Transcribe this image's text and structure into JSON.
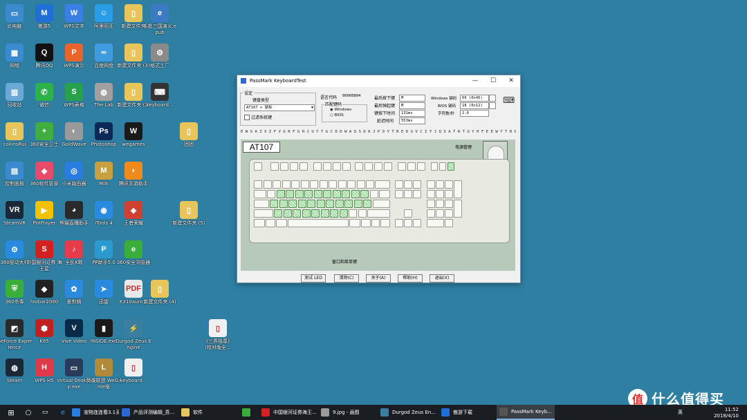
{
  "desktop": {
    "icons": [
      {
        "label": "此电脑",
        "color": "#3a8ad0",
        "glyph": "▭"
      },
      {
        "label": "傲游5",
        "color": "#1f6fd6",
        "glyph": "M"
      },
      {
        "label": "WPS文字",
        "color": "#3a7ee6",
        "glyph": "W"
      },
      {
        "label": "阿里旺旺",
        "color": "#2a9de8",
        "glyph": "☺"
      },
      {
        "label": "新建文件夹",
        "color": "#e8c55a",
        "glyph": "▯"
      },
      {
        "label": "毛批三国演义.epub",
        "color": "#3b7bc4",
        "glyph": "e"
      },
      {
        "label": "网络",
        "color": "#3a8ad0",
        "glyph": "▦"
      },
      {
        "label": "腾讯QQ",
        "color": "#111111",
        "glyph": "Q"
      },
      {
        "label": "WPS演示",
        "color": "#e8642a",
        "glyph": "P"
      },
      {
        "label": "百度网盘",
        "color": "#3f9be0",
        "glyph": "∞"
      },
      {
        "label": "新建文件夹 (3)",
        "color": "#e8c55a",
        "glyph": "▯"
      },
      {
        "label": "格式工厂",
        "color": "#8a8a8a",
        "glyph": "⚙"
      },
      {
        "label": "回收站",
        "color": "#6aa8d8",
        "glyph": "▥"
      },
      {
        "label": "微信",
        "color": "#2db14b",
        "glyph": "✆"
      },
      {
        "label": "WPS表格",
        "color": "#27a14b",
        "glyph": "S"
      },
      {
        "label": "The Lab",
        "color": "#a0a0a0",
        "glyph": "◍"
      },
      {
        "label": "新建文件夹 (2)",
        "color": "#e8c55a",
        "glyph": "▯"
      },
      {
        "label": "keyboard...",
        "color": "#333333",
        "glyph": "⌨"
      },
      {
        "label": "collinsRui",
        "color": "#e8c55a",
        "glyph": "▯"
      },
      {
        "label": "360安全卫士",
        "color": "#3fae3f",
        "glyph": "+"
      },
      {
        "label": "GoldWave",
        "color": "#9a9a9a",
        "glyph": "◐"
      },
      {
        "label": "Photoshop",
        "color": "#0b2a5a",
        "glyph": "Ps"
      },
      {
        "label": "wegames",
        "color": "#1a1a1a",
        "glyph": "W"
      },
      {
        "label": "团团",
        "color": "#e8c55a",
        "glyph": "▯"
      },
      {
        "label": "控制面板",
        "color": "#3a8ad0",
        "glyph": "▤"
      },
      {
        "label": "360软件管家",
        "color": "#e84a6a",
        "glyph": "◆"
      },
      {
        "label": "小米路由器",
        "color": "#2a7de0",
        "glyph": "◎"
      },
      {
        "label": "Milk",
        "color": "#c8a040",
        "glyph": "M"
      },
      {
        "label": "腾讯手游助手",
        "color": "#f08a1a",
        "glyph": "◗"
      },
      {
        "label": "SteamVR",
        "color": "#1b2838",
        "glyph": "VR"
      },
      {
        "label": "PotPlayer",
        "color": "#f2c200",
        "glyph": "▶"
      },
      {
        "label": "熊猫直播助手",
        "color": "#2a2a2a",
        "glyph": "◕"
      },
      {
        "label": "iTools 4",
        "color": "#2a8ae0",
        "glyph": "◉"
      },
      {
        "label": "王者荣耀",
        "color": "#d04030",
        "glyph": "◈"
      },
      {
        "label": "新建文件夹 (5)",
        "color": "#e8c55a",
        "glyph": "▯"
      },
      {
        "label": "360驱动大师",
        "color": "#2a8ae0",
        "glyph": "⚙"
      },
      {
        "label": "中国银河证券 海王星",
        "color": "#d42020",
        "glyph": "S"
      },
      {
        "label": "全民K歌",
        "color": "#e83a4a",
        "glyph": "♪"
      },
      {
        "label": "PP助手5.0",
        "color": "#2a9ad0",
        "glyph": "P"
      },
      {
        "label": "360安全浏览器",
        "color": "#3aae3a",
        "glyph": "e"
      },
      {
        "label": "360杀毒",
        "color": "#3aae3a",
        "glyph": "⛨"
      },
      {
        "label": "foobar2000",
        "color": "#222222",
        "glyph": "◆"
      },
      {
        "label": "爱剪辑",
        "color": "#2a8ae0",
        "glyph": "✿"
      },
      {
        "label": "迅雷",
        "color": "#2a8ae0",
        "glyph": "➤"
      },
      {
        "label": "K310auro...",
        "color": "#e8e8e8",
        "glyph": "PDF"
      },
      {
        "label": "新建文件夹 (4)",
        "color": "#e8c55a",
        "glyph": "▯"
      },
      {
        "label": "GeForce Experience",
        "color": "#2a2a2a",
        "glyph": "◩"
      },
      {
        "label": "K85",
        "color": "#c02020",
        "glyph": "⬢"
      },
      {
        "label": "Vive Video",
        "color": "#0a2a4a",
        "glyph": "V"
      },
      {
        "label": "INSIDE.exe",
        "color": "#1a1a1a",
        "glyph": "▮"
      },
      {
        "label": "Durgod Zeus Engine",
        "color": "#3a7ea0",
        "glyph": "⚡"
      },
      {
        "label": "《三界独尊》 (校对版全...",
        "color": "#f0f0f0",
        "glyph": "▯"
      },
      {
        "label": "Steam",
        "color": "#1b2838",
        "glyph": "◍"
      },
      {
        "label": "WPS H5",
        "color": "#e03a4a",
        "glyph": "H"
      },
      {
        "label": "Virtual Desktop.exe",
        "color": "#2a3a5a",
        "glyph": "▭"
      },
      {
        "label": "英雄联盟 WeGame版",
        "color": "#b08a3a",
        "glyph": "L"
      },
      {
        "label": "keyboard...",
        "color": "#f0f0f0",
        "glyph": "▯"
      }
    ]
  },
  "window": {
    "title": "PassMark KeyboardTest",
    "minimize_glyph": "—",
    "maximize_glyph": "☐",
    "close_glyph": "✕",
    "settings_label": "设定",
    "keyboard_type_label": "键盘类型",
    "keyboard_type_value": "AT107 + 鼠标",
    "filter_keys_label": "过滤系统键",
    "lang_code_label": "语言代码",
    "lang_code_value": "00000804",
    "scancode_label": "匹配键码",
    "scancode_options": [
      "Windows",
      "BIOS"
    ],
    "last_down_label": "最后按下键",
    "last_down_value": "M",
    "last_up_label": "最后弹起键",
    "last_up_value": "M",
    "key_down_time_label": "键按下时间",
    "key_down_time_value": "131ms",
    "delay_label": "延迟时间",
    "delay_value": "553ms",
    "windows_code_label": "Windows 键码",
    "windows_code_value": "69 (0x45)",
    "bios_code_label": "BIOS 键码",
    "bios_code_value": "18 (0x12)",
    "chars_per_sec_label": "字符数/秒",
    "chars_per_sec_value": "2.6",
    "letters_row": "E W S A Z X Z F V G R F G H J U Y T G C D D W A Q S D K J P O Y T R E D S V C I Y J Q S A T R T U Y H F E E W Y T R D S D V F",
    "keyboard_model": "AT107",
    "power_mgmt_label": "电源管理",
    "windows_keys_label": "窗口和菜单键",
    "buttons": {
      "test_led": "测试 LED",
      "clear": "清除(C)",
      "about": "关于(A)",
      "help": "帮助(H)",
      "exit": "退出(X)"
    }
  },
  "taskbar": {
    "items": [
      {
        "label": "宠物连连看3.1无...",
        "color": "#2a7de0"
      },
      {
        "label": "产品评测编辑_吾...",
        "color": "#2a6ad0"
      },
      {
        "label": "软件",
        "color": "#e8c55a"
      },
      {
        "label": "",
        "color": "#3aae3a"
      },
      {
        "label": "中国银河证券海王...",
        "color": "#d42020"
      },
      {
        "label": "9.jpg - 画图",
        "color": "#9a9a9a"
      },
      {
        "label": "Durgod Zeus En...",
        "color": "#3a7ea0"
      },
      {
        "label": "傲游下载",
        "color": "#1f6fd6"
      },
      {
        "label": "PassMark Keyb...",
        "color": "#555555"
      }
    ],
    "tray_lang": "英",
    "clock_time": "11:52",
    "clock_date": "2018/4/10"
  },
  "watermark": {
    "badge": "值",
    "text": "什么值得买"
  }
}
